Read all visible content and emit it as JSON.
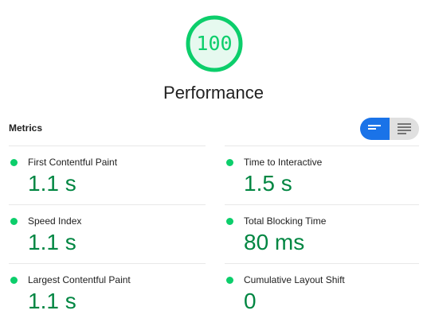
{
  "gauge": {
    "score": "100",
    "fraction": 1.0,
    "color": "#0cce6b",
    "bg_color": "#e6f9ef"
  },
  "category": {
    "title": "Performance"
  },
  "metrics_section": {
    "header": "Metrics",
    "toggle": {
      "active_icon": "lines-short-icon",
      "inactive_icon": "lines-long-icon",
      "active_color": "#1a73e8"
    }
  },
  "metrics": {
    "left": [
      {
        "title": "First Contentful Paint",
        "value": "1.1 s",
        "status": "pass"
      },
      {
        "title": "Speed Index",
        "value": "1.1 s",
        "status": "pass"
      },
      {
        "title": "Largest Contentful Paint",
        "value": "1.1 s",
        "status": "pass"
      }
    ],
    "right": [
      {
        "title": "Time to Interactive",
        "value": "1.5 s",
        "status": "pass"
      },
      {
        "title": "Total Blocking Time",
        "value": "80 ms",
        "status": "pass"
      },
      {
        "title": "Cumulative Layout Shift",
        "value": "0",
        "status": "pass"
      }
    ]
  },
  "colors": {
    "pass": "#0cce6b",
    "pass_text": "#018642"
  }
}
